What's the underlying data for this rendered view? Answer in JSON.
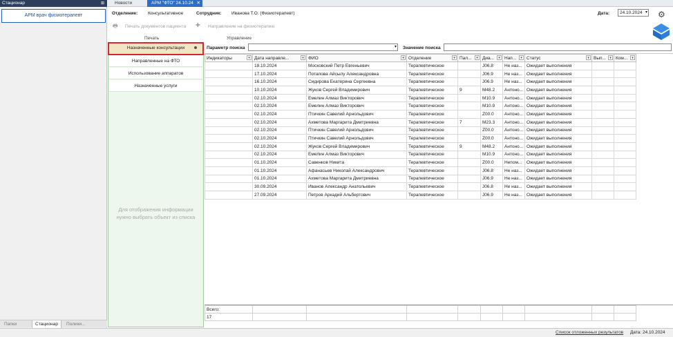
{
  "left_panel": {
    "header": "Стационар",
    "arm_label": "АРМ врач физиотерапевт",
    "bottom_tabs": [
      "Папки",
      "Стационар",
      "Полики..."
    ]
  },
  "top_tabs": [
    {
      "label": "Новости",
      "active": false
    },
    {
      "label": "АРМ \"ФТО\" 24.10.24",
      "active": true
    }
  ],
  "header": {
    "department_label": "Отделение:",
    "department_value": "Консультативное",
    "employee_label": "Сотрудник:",
    "employee_value": "Иванова Т.О. (Физиотерапевт)",
    "date_label": "Дата:",
    "date_value": "24.10.2024"
  },
  "toolbar": {
    "print_docs_label": "Печать документов пациента",
    "direction_label": "Направление на физиотерапию",
    "print_group": "Печать",
    "manage_group": "Управление"
  },
  "nav": {
    "items": [
      "Назначенные консультации",
      "Направленные на ФТО",
      "Использование аппаратов",
      "Назначенные услуги"
    ],
    "selected_index": 0,
    "empty_hint_line1": "Для отображения информации",
    "empty_hint_line2": "нужно выбрать объект из списка"
  },
  "search": {
    "param_label": "Параметр поиска",
    "value_label": "Значение поиска",
    "param_value": "",
    "value_value": ""
  },
  "grid": {
    "columns": [
      "Индикаторы",
      "Дата направле...",
      "ФИО",
      "Отделение",
      "Пал...",
      "Диа...",
      "Нап...",
      "Статус",
      "Вып...",
      "Ком..."
    ],
    "rows": [
      [
        "",
        "18.10.2024",
        "Московский Петр Евгеньевич",
        "Терапевтическое",
        "",
        "J06.8",
        "Не наз...",
        "Ожидает выполнения",
        "",
        ""
      ],
      [
        "",
        "17.10.2024",
        "Потапова Айсылу Александровна",
        "Терапевтическое",
        "",
        "J06.9",
        "Не наз...",
        "Ожидает выполнения",
        "",
        ""
      ],
      [
        "",
        "16.10.2024",
        "Сидирова Екатерина Сергеевна",
        "Терапевтическое",
        "",
        "J06.9",
        "Не наз...",
        "Ожидает выполнения",
        "",
        ""
      ],
      [
        "",
        "10.10.2024",
        "Жуков Сергей Владимирович",
        "Терапевтическое",
        "9",
        "M48.2",
        "Антоно...",
        "Ожидает выполнения",
        "",
        ""
      ],
      [
        "",
        "02.10.2024",
        "Емелин Алмаз Викторович",
        "Терапевтическое",
        "",
        "M10.9",
        "Антоно...",
        "Ожидает выполнения",
        "",
        ""
      ],
      [
        "",
        "02.10.2024",
        "Емелин Алмаз Викторович",
        "Терапевтическое",
        "",
        "M10.9",
        "Антоно...",
        "Ожидает выполнения",
        "",
        ""
      ],
      [
        "",
        "02.10.2024",
        "Птичкин Савелий Арнольдович",
        "Терапевтическое",
        "",
        "Z00.0",
        "Антоно...",
        "Ожидает выполнения",
        "",
        ""
      ],
      [
        "",
        "02.10.2024",
        "Ахметова Маргарита Дмитриевна",
        "Терапевтическое",
        "7",
        "M23.3",
        "Антоно...",
        "Ожидает выполнения",
        "",
        ""
      ],
      [
        "",
        "02.10.2024",
        "Птичкин Савелий Арнольдович",
        "Терапевтическое",
        "",
        "Z00.0",
        "Антоно...",
        "Ожидает выполнения",
        "",
        ""
      ],
      [
        "",
        "02.10.2024",
        "Птичкин Савелий Арнольдович",
        "Терапевтическое",
        "",
        "Z00.0",
        "Антоно...",
        "Ожидает выполнения",
        "",
        ""
      ],
      [
        "",
        "02.10.2024",
        "Жуков Сергей Владимирович",
        "Терапевтическое",
        "9",
        "M48.2",
        "Антоно...",
        "Ожидает выполнения",
        "",
        ""
      ],
      [
        "",
        "02.10.2024",
        "Емелин Алмаз Викторович",
        "Терапевтическое",
        "",
        "M10.9",
        "Антоно...",
        "Ожидает выполнения",
        "",
        ""
      ],
      [
        "",
        "01.10.2024",
        "Савенков Никита",
        "Терапевтическое",
        "",
        "Z00.0",
        "Непом...",
        "Ожидает выполнения",
        "",
        ""
      ],
      [
        "",
        "01.10.2024",
        "Афанасьев Николай Александрович",
        "Терапевтическое",
        "",
        "J06.8",
        "Не наз...",
        "Ожидает выполнения",
        "",
        ""
      ],
      [
        "",
        "01.10.2024",
        "Ахметова Маргарита Дмитриевна",
        "Терапевтическое",
        "",
        "J06.9",
        "Не наз...",
        "Ожидает выполнения",
        "",
        ""
      ],
      [
        "",
        "30.09.2024",
        "Иванов Александр Анатольевич",
        "Терапевтическое",
        "",
        "J06.8",
        "Не наз...",
        "Ожидает выполнения",
        "",
        ""
      ],
      [
        "",
        "27.09.2024",
        "Петров Аркадий Альбертович",
        "Терапевтическое",
        "",
        "J06.9",
        "Не наз...",
        "Ожидает выполнения",
        "",
        ""
      ]
    ],
    "total_label": "Всего:",
    "total_value": "17"
  },
  "status_bar": {
    "deferred_link": "Список отложенных результатов",
    "date_text": "Дата: 24.10.2024"
  },
  "colors": {
    "accent": "#2e6ec4",
    "selected_nav": "#f2e5c4",
    "selected_border": "#d8262e",
    "nav_bg": "#eef7ee"
  }
}
